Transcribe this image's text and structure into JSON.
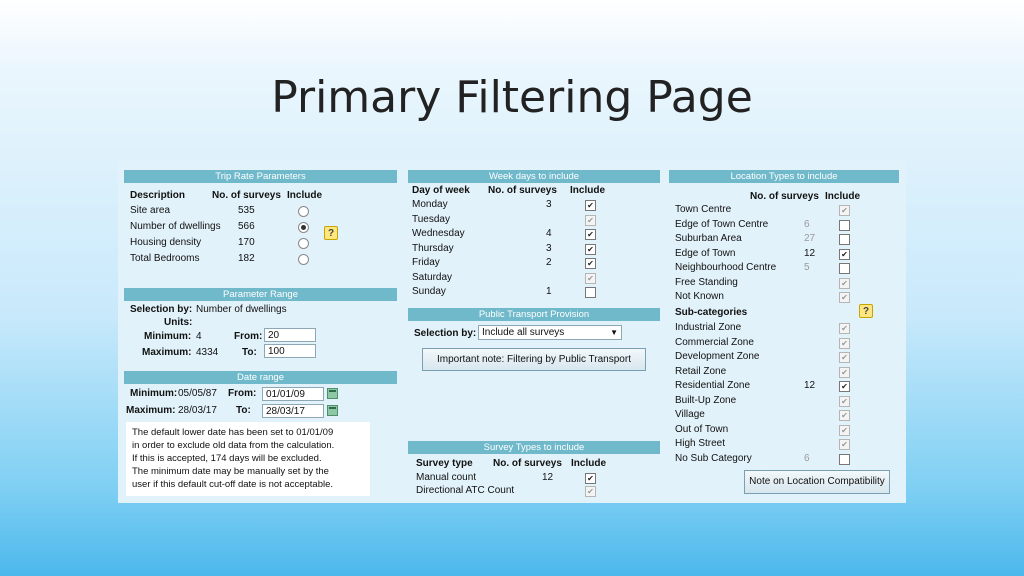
{
  "slide_title": "Primary Filtering Page",
  "trip_rate": {
    "header": "Trip Rate Parameters",
    "col_description": "Description",
    "col_surveys": "No. of surveys",
    "col_include": "Include",
    "rows": [
      {
        "label": "Site area",
        "count": "535",
        "selected": false
      },
      {
        "label": "Number of dwellings",
        "count": "566",
        "selected": true
      },
      {
        "label": "Housing density",
        "count": "170",
        "selected": false
      },
      {
        "label": "Total Bedrooms",
        "count": "182",
        "selected": false
      }
    ],
    "help_icon": "?"
  },
  "parameter_range": {
    "header": "Parameter Range",
    "selection_label": "Selection by:",
    "selection_value": "Number of dwellings",
    "units_label": "Units:",
    "minimum_label": "Minimum:",
    "minimum_value": "4",
    "maximum_label": "Maximum:",
    "maximum_value": "4334",
    "from_label": "From:",
    "from_value": "20",
    "to_label": "To:",
    "to_value": "100"
  },
  "date_range": {
    "header": "Date range",
    "minimum_label": "Minimum:",
    "minimum_value": "05/05/87",
    "maximum_label": "Maximum:",
    "maximum_value": "28/03/17",
    "from_label": "From:",
    "from_value": "01/01/09",
    "to_label": "To:",
    "to_value": "28/03/17",
    "note_lines": [
      "The default lower date has been set to 01/01/09",
      "in order to exclude old data from the calculation.",
      "If this is accepted, 174 days will be excluded.",
      "The minimum date may be manually set by the",
      "user if this default cut-off date is not acceptable."
    ]
  },
  "week_days": {
    "header": "Week days to include",
    "col_day": "Day of week",
    "col_surveys": "No. of surveys",
    "col_include": "Include",
    "rows": [
      {
        "label": "Monday",
        "count": "3",
        "checked": true,
        "disabled": false
      },
      {
        "label": "Tuesday",
        "count": "",
        "checked": true,
        "disabled": true
      },
      {
        "label": "Wednesday",
        "count": "4",
        "checked": true,
        "disabled": false
      },
      {
        "label": "Thursday",
        "count": "3",
        "checked": true,
        "disabled": false
      },
      {
        "label": "Friday",
        "count": "2",
        "checked": true,
        "disabled": false
      },
      {
        "label": "Saturday",
        "count": "",
        "checked": true,
        "disabled": true
      },
      {
        "label": "Sunday",
        "count": "1",
        "checked": false,
        "disabled": false
      }
    ]
  },
  "public_transport": {
    "header": "Public Transport Provision",
    "selection_label": "Selection by:",
    "select_value": "Include all surveys",
    "note_button": "Important note: Filtering by Public Transport"
  },
  "survey_types": {
    "header": "Survey Types to include",
    "col_type": "Survey type",
    "col_surveys": "No. of surveys",
    "col_include": "Include",
    "rows": [
      {
        "label": "Manual count",
        "count": "12",
        "checked": true,
        "disabled": false
      },
      {
        "label": "Directional ATC Count",
        "count": "",
        "checked": true,
        "disabled": true
      }
    ]
  },
  "location_types": {
    "header": "Location Types to include",
    "col_surveys": "No. of surveys",
    "col_include": "Include",
    "rows": [
      {
        "label": "Town Centre",
        "count": "",
        "checked": true,
        "disabled": true
      },
      {
        "label": "Edge of Town Centre",
        "count": "6",
        "checked": false,
        "disabled": false,
        "dim": true
      },
      {
        "label": "Suburban Area",
        "count": "27",
        "checked": false,
        "disabled": false,
        "dim": true
      },
      {
        "label": "Edge of Town",
        "count": "12",
        "checked": true,
        "disabled": false
      },
      {
        "label": "Neighbourhood Centre",
        "count": "5",
        "checked": false,
        "disabled": false,
        "dim": true
      },
      {
        "label": "Free Standing",
        "count": "",
        "checked": true,
        "disabled": true
      },
      {
        "label": "Not Known",
        "count": "",
        "checked": true,
        "disabled": true
      }
    ],
    "sub_header": "Sub-categories",
    "sub_rows": [
      {
        "label": "Industrial Zone",
        "count": "",
        "checked": true,
        "disabled": true
      },
      {
        "label": "Commercial Zone",
        "count": "",
        "checked": true,
        "disabled": true
      },
      {
        "label": "Development Zone",
        "count": "",
        "checked": true,
        "disabled": true
      },
      {
        "label": "Retail Zone",
        "count": "",
        "checked": true,
        "disabled": true
      },
      {
        "label": "Residential Zone",
        "count": "12",
        "checked": true,
        "disabled": false
      },
      {
        "label": "Built-Up Zone",
        "count": "",
        "checked": true,
        "disabled": true
      },
      {
        "label": "Village",
        "count": "",
        "checked": true,
        "disabled": true
      },
      {
        "label": "Out of Town",
        "count": "",
        "checked": true,
        "disabled": true
      },
      {
        "label": "High Street",
        "count": "",
        "checked": true,
        "disabled": true
      },
      {
        "label": "No Sub Category",
        "count": "6",
        "checked": false,
        "disabled": false,
        "dim": true
      }
    ],
    "note_button": "Note on Location Compatibility",
    "help_icon": "?"
  }
}
